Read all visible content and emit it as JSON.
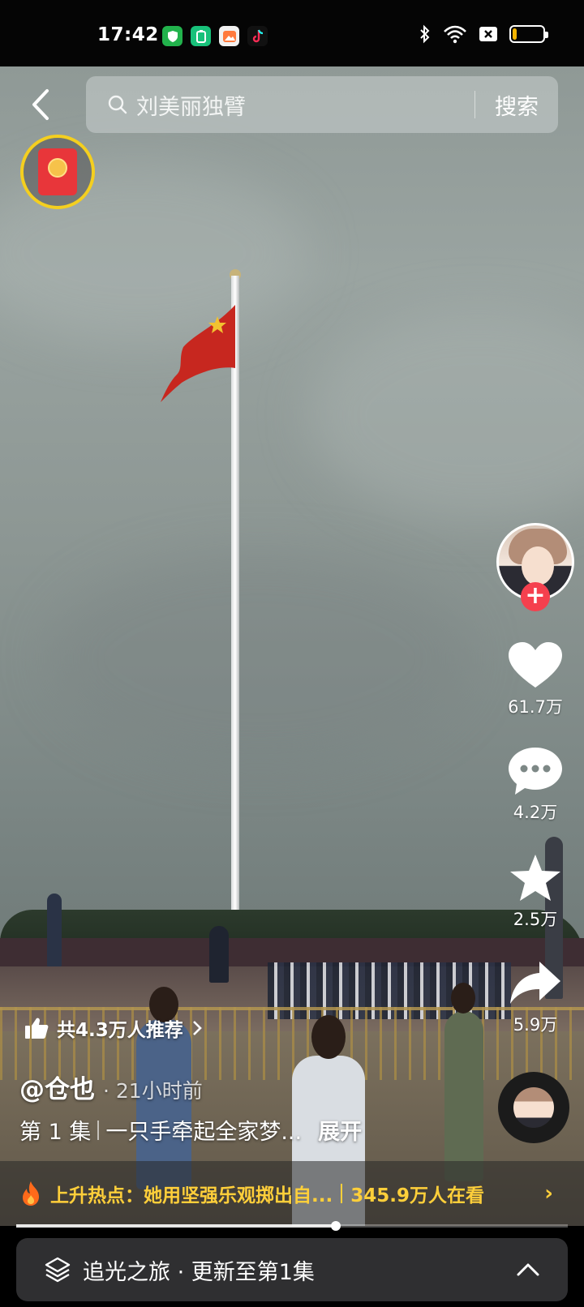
{
  "status_bar": {
    "time": "17:42",
    "battery_level": 0.15,
    "battery_color": "#f4b400",
    "apps": [
      "vpn-shield-icon",
      "battery-saver-icon",
      "gallery-app-icon",
      "tiktok-icon"
    ],
    "system_icons": [
      "bluetooth-icon",
      "wifi-icon",
      "notification-x-icon",
      "battery-icon"
    ]
  },
  "search": {
    "placeholder": "刘美丽独臂",
    "button_label": "搜索"
  },
  "right_rail": {
    "likes": "61.7万",
    "comments": "4.2万",
    "favorites": "2.5万",
    "shares": "5.9万",
    "follow_label": "+"
  },
  "caption": {
    "recommend_text": "共4.3万人推荐",
    "author": "@仓也",
    "time_ago": "· 21小时前",
    "episode": "第 1 集",
    "description": "一只手牵起全家梦...",
    "expand_label": "展开"
  },
  "hot_topic": {
    "prefix": "上升热点：",
    "title": "她用坚强乐观掷出自...",
    "viewers": "345.9万人在看",
    "arrow": "›"
  },
  "playback": {
    "progress": 0.58
  },
  "series": {
    "label": "追光之旅 · 更新至第1集"
  },
  "colors": {
    "accent_yellow": "#ffcf3a",
    "follow_red": "#f5404e",
    "redpacket_border": "#f4cf1f"
  }
}
